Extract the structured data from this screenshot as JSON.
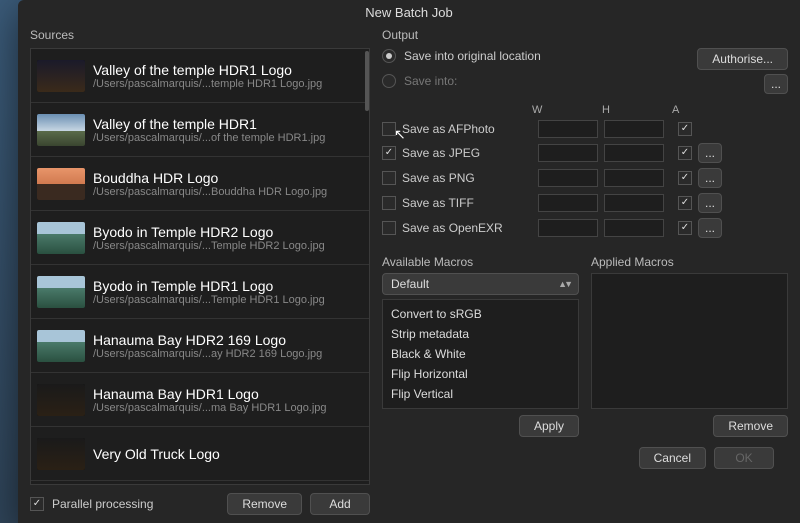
{
  "title": "New Batch Job",
  "sources_label": "Sources",
  "sources": [
    {
      "title": "Valley of the temple HDR1 Logo",
      "path": "/Users/pascalmarquis/...temple HDR1 Logo.jpg",
      "thumbClass": "night"
    },
    {
      "title": "Valley of the temple HDR1",
      "path": "/Users/pascalmarquis/...of the temple HDR1.jpg",
      "thumbClass": "sky"
    },
    {
      "title": "Bouddha HDR Logo",
      "path": "/Users/pascalmarquis/...Bouddha HDR Logo.jpg",
      "thumbClass": "temple"
    },
    {
      "title": "Byodo in Temple HDR2 Logo",
      "path": "/Users/pascalmarquis/...Temple HDR2 Logo.jpg",
      "thumbClass": "beach"
    },
    {
      "title": "Byodo in Temple HDR1 Logo",
      "path": "/Users/pascalmarquis/...Temple HDR1 Logo.jpg",
      "thumbClass": "beach"
    },
    {
      "title": "Hanauma Bay HDR2 169 Logo",
      "path": "/Users/pascalmarquis/...ay HDR2 169 Logo.jpg",
      "thumbClass": "beach"
    },
    {
      "title": "Hanauma Bay HDR1 Logo",
      "path": "/Users/pascalmarquis/...ma Bay HDR1 Logo.jpg",
      "thumbClass": "dark"
    },
    {
      "title": "Very Old Truck Logo",
      "path": "",
      "thumbClass": "dark"
    }
  ],
  "parallel_processing": "Parallel processing",
  "remove_btn": "Remove",
  "add_btn": "Add",
  "output_label": "Output",
  "save_original": "Save into original location",
  "save_into": "Save into:",
  "authorise": "Authorise...",
  "ellipsis": "...",
  "col_w": "W",
  "col_h": "H",
  "col_a": "A",
  "formats": [
    {
      "label": "Save as AFPhoto",
      "checked": false,
      "a": true,
      "opts": false,
      "cursor": true
    },
    {
      "label": "Save as JPEG",
      "checked": true,
      "a": true,
      "opts": true
    },
    {
      "label": "Save as PNG",
      "checked": false,
      "a": true,
      "opts": true
    },
    {
      "label": "Save as TIFF",
      "checked": false,
      "a": true,
      "opts": true
    },
    {
      "label": "Save as OpenEXR",
      "checked": false,
      "a": true,
      "opts": true
    }
  ],
  "available_macros": "Available Macros",
  "applied_macros": "Applied Macros",
  "macros_dropdown": "Default",
  "macros": [
    "Convert to sRGB",
    "Strip metadata",
    "Black & White",
    "Flip Horizontal",
    "Flip Vertical"
  ],
  "apply_btn": "Apply",
  "remove_macro_btn": "Remove",
  "cancel_btn": "Cancel",
  "ok_btn": "OK"
}
